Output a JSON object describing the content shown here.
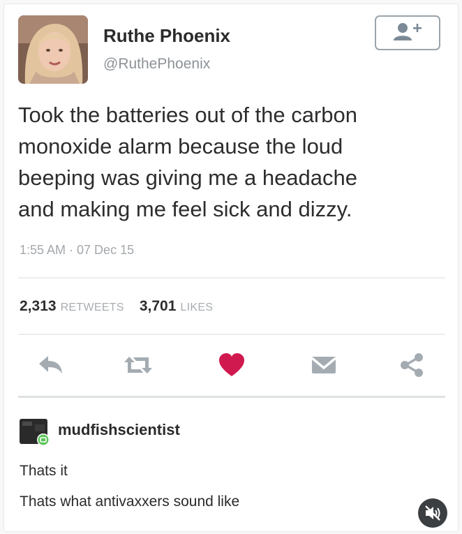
{
  "tweet": {
    "display_name": "Ruthe Phoenix",
    "handle": "@RuthePhoenix",
    "text_lines": [
      "Took the batteries out of the carbon",
      "monoxide alarm because the loud",
      "beeping was giving me a headache",
      "and making me feel sick and dizzy."
    ],
    "timestamp": "1:55 AM · 07 Dec 15",
    "retweets_count": "2,313",
    "retweets_label": "RETWEETS",
    "likes_count": "3,701",
    "likes_label": "LIKES",
    "follow_icon": "follow-user-plus-icon",
    "actions": [
      "reply-icon",
      "retweet-icon",
      "like-heart-icon",
      "direct-message-icon",
      "share-icon"
    ],
    "colors": {
      "like_heart": "#d01a4f",
      "icon_gray": "#a4acb2"
    }
  },
  "reply": {
    "username": "mudfishscientist",
    "lines": [
      "Thats it",
      "Thats what antivaxxers sound like"
    ]
  },
  "video": {
    "mute_icon": "muted-speaker-icon"
  }
}
